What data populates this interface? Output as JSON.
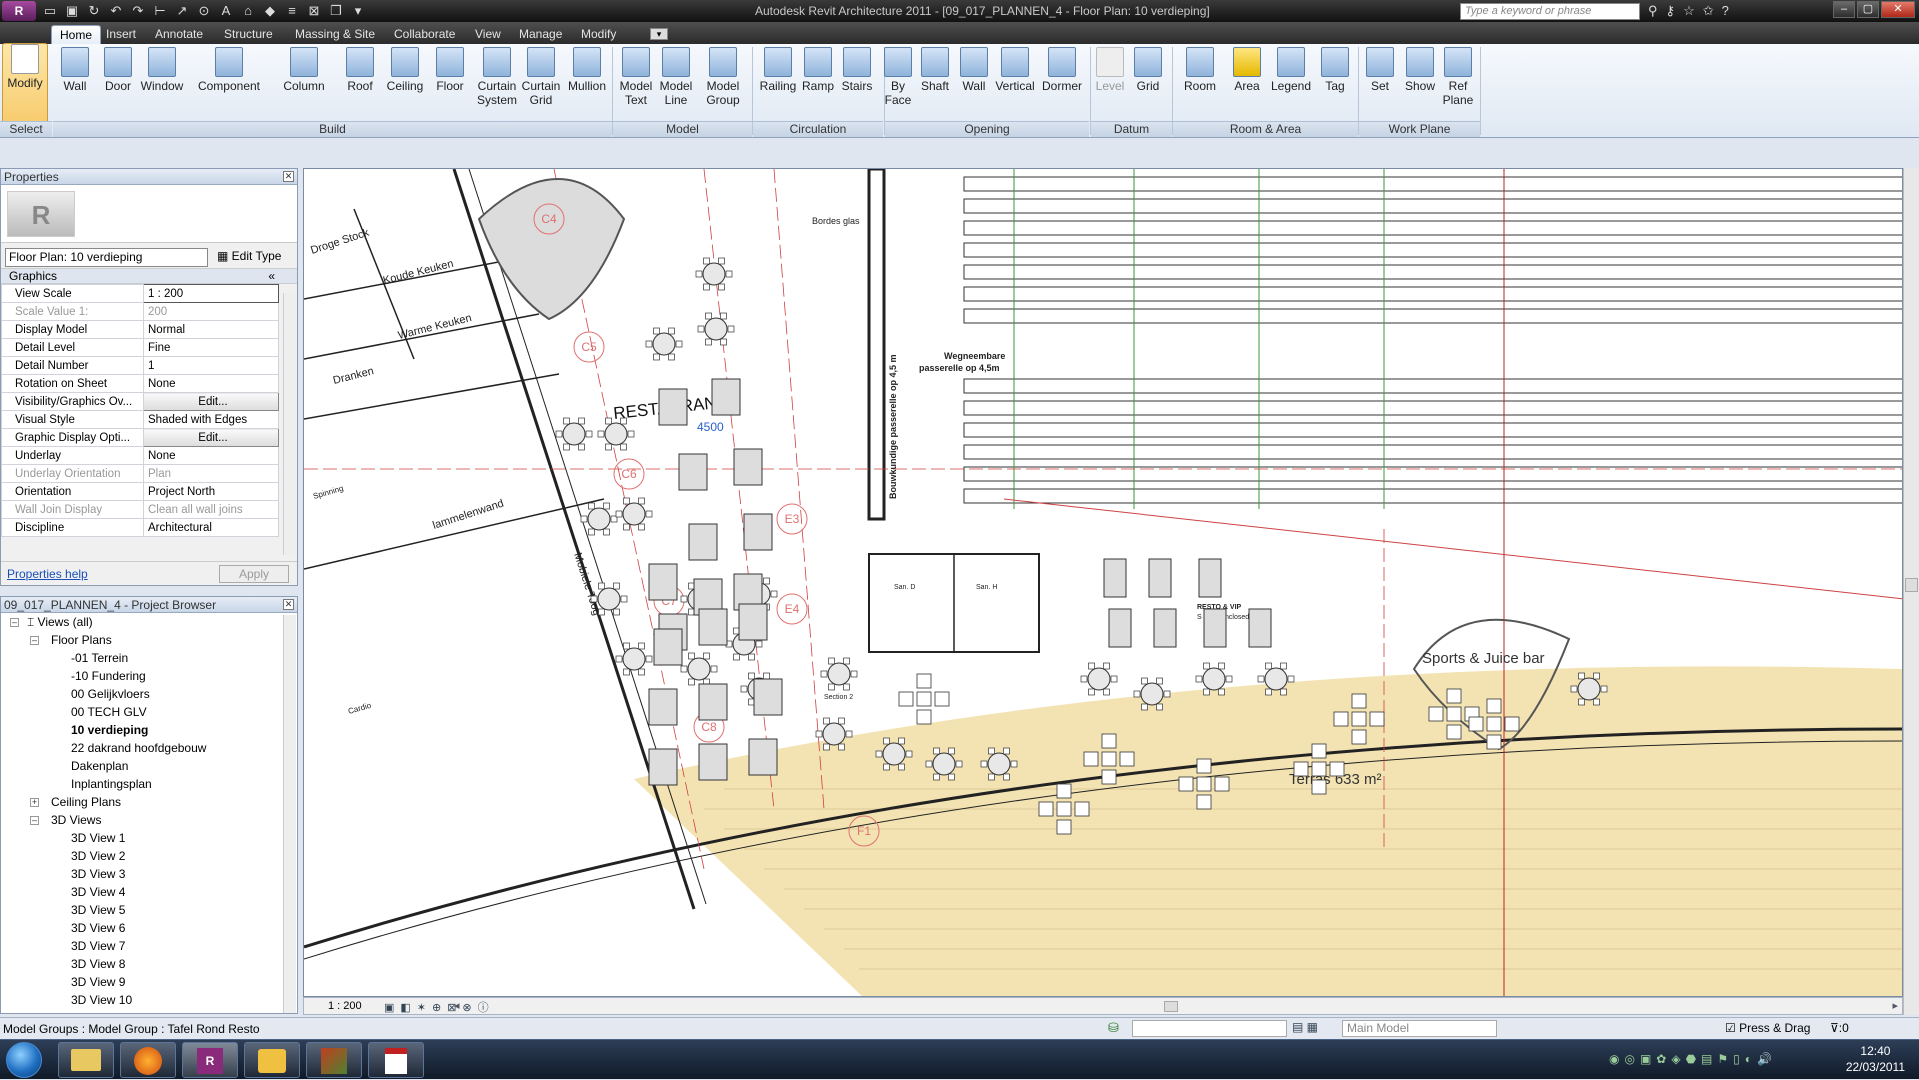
{
  "titlebar": {
    "app_letter": "R",
    "title": "Autodesk Revit Architecture 2011 - [09_017_PLANNEN_4 - Floor Plan: 10 verdieping]",
    "search_placeholder": "Type a keyword or phrase"
  },
  "tabs": [
    "Home",
    "Insert",
    "Annotate",
    "Structure",
    "Massing & Site",
    "Collaborate",
    "View",
    "Manage",
    "Modify"
  ],
  "ribbon": {
    "buttons": [
      {
        "label": "Modify"
      },
      {
        "label": "Wall"
      },
      {
        "label": "Door"
      },
      {
        "label": "Window"
      },
      {
        "label": "Component"
      },
      {
        "label": "Column"
      },
      {
        "label": "Roof"
      },
      {
        "label": "Ceiling"
      },
      {
        "label": "Floor"
      },
      {
        "label": "Curtain System"
      },
      {
        "label": "Curtain Grid"
      },
      {
        "label": "Mullion"
      },
      {
        "label": "Model Text"
      },
      {
        "label": "Model Line"
      },
      {
        "label": "Model Group"
      },
      {
        "label": "Railing"
      },
      {
        "label": "Ramp"
      },
      {
        "label": "Stairs"
      },
      {
        "label": "By Face"
      },
      {
        "label": "Shaft"
      },
      {
        "label": "Wall"
      },
      {
        "label": "Vertical"
      },
      {
        "label": "Dormer"
      },
      {
        "label": "Level"
      },
      {
        "label": "Grid"
      },
      {
        "label": "Room"
      },
      {
        "label": "Area"
      },
      {
        "label": "Legend"
      },
      {
        "label": "Tag"
      },
      {
        "label": "Set"
      },
      {
        "label": "Show"
      },
      {
        "label": "Ref Plane"
      }
    ],
    "groups": [
      "Select",
      "Build",
      "Model",
      "Circulation",
      "Opening",
      "Datum",
      "Room & Area",
      "Work Plane"
    ]
  },
  "properties": {
    "title": "Properties",
    "type_selector": "Floor Plan: 10 verdieping",
    "edit_type": "Edit Type",
    "group": "Graphics",
    "rows": [
      {
        "name": "View Scale",
        "value": "1 : 200"
      },
      {
        "name": "Scale Value    1:",
        "value": "200"
      },
      {
        "name": "Display Model",
        "value": "Normal"
      },
      {
        "name": "Detail Level",
        "value": "Fine"
      },
      {
        "name": "Detail Number",
        "value": "1"
      },
      {
        "name": "Rotation on Sheet",
        "value": "None"
      },
      {
        "name": "Visibility/Graphics Ov...",
        "value": "Edit..."
      },
      {
        "name": "Visual Style",
        "value": "Shaded with Edges"
      },
      {
        "name": "Graphic Display Opti...",
        "value": "Edit..."
      },
      {
        "name": "Underlay",
        "value": "None"
      },
      {
        "name": "Underlay Orientation",
        "value": "Plan"
      },
      {
        "name": "Orientation",
        "value": "Project North"
      },
      {
        "name": "Wall Join Display",
        "value": "Clean all wall joins"
      },
      {
        "name": "Discipline",
        "value": "Architectural"
      }
    ],
    "help_link": "Properties help",
    "apply": "Apply"
  },
  "browser": {
    "title": "09_017_PLANNEN_4 - Project Browser",
    "items": [
      {
        "label": "Views (all)"
      },
      {
        "label": "Floor Plans"
      },
      {
        "label": "-01 Terrein"
      },
      {
        "label": "-10 Fundering"
      },
      {
        "label": "00 Gelijkvloers"
      },
      {
        "label": "00 TECH GLV"
      },
      {
        "label": "10 verdieping"
      },
      {
        "label": "22 dakrand hoofdgebouw"
      },
      {
        "label": "Dakenplan"
      },
      {
        "label": "Inplantingsplan"
      },
      {
        "label": "Ceiling Plans"
      },
      {
        "label": "3D Views"
      },
      {
        "label": "3D View 1"
      },
      {
        "label": "3D View 2"
      },
      {
        "label": "3D View 3"
      },
      {
        "label": "3D View 4"
      },
      {
        "label": "3D View 5"
      },
      {
        "label": "3D View 6"
      },
      {
        "label": "3D View 7"
      },
      {
        "label": "3D View 8"
      },
      {
        "label": "3D View 9"
      },
      {
        "label": "3D View 10"
      }
    ]
  },
  "drawing": {
    "labels": {
      "restaurant": "RESTAURANT",
      "dim4500": "4500",
      "koude": "Koude Keuken",
      "warme": "Warme Keuken",
      "droge": "Droge Stock",
      "dranken": "Dranken",
      "lamellen": "lammelenwand",
      "mobiele": "Mobiele Toog",
      "bordes": "Bordes glas",
      "wegneem": "Wegneembare",
      "passerelle": "passerelle op 4,5m",
      "bouwkundige": "Bouwkundige passerelle op 4,5 m",
      "resto": "RESTO & VIP",
      "not_enclosed": "S : Not Enclosed",
      "sports": "Sports & Juice bar",
      "terras": "Terras 633 m²",
      "section": "Section 2",
      "c4": "C4",
      "c5": "C5",
      "c6": "C6",
      "c7": "C7",
      "c8": "C8",
      "e3": "E3",
      "e4": "E4",
      "f1": "F1",
      "spinning": "Spinning",
      "cardio": "Cardio",
      "san_d": "San. D",
      "san_h": "San. H"
    }
  },
  "view_scale": "1 : 200",
  "statusbar": {
    "left": "Model Groups : Model Group : Tafel Rond Resto",
    "model": "Main Model",
    "press_drag": "Press & Drag",
    "filter": ":0"
  },
  "clock": {
    "time": "12:40",
    "date": "22/03/2011"
  }
}
